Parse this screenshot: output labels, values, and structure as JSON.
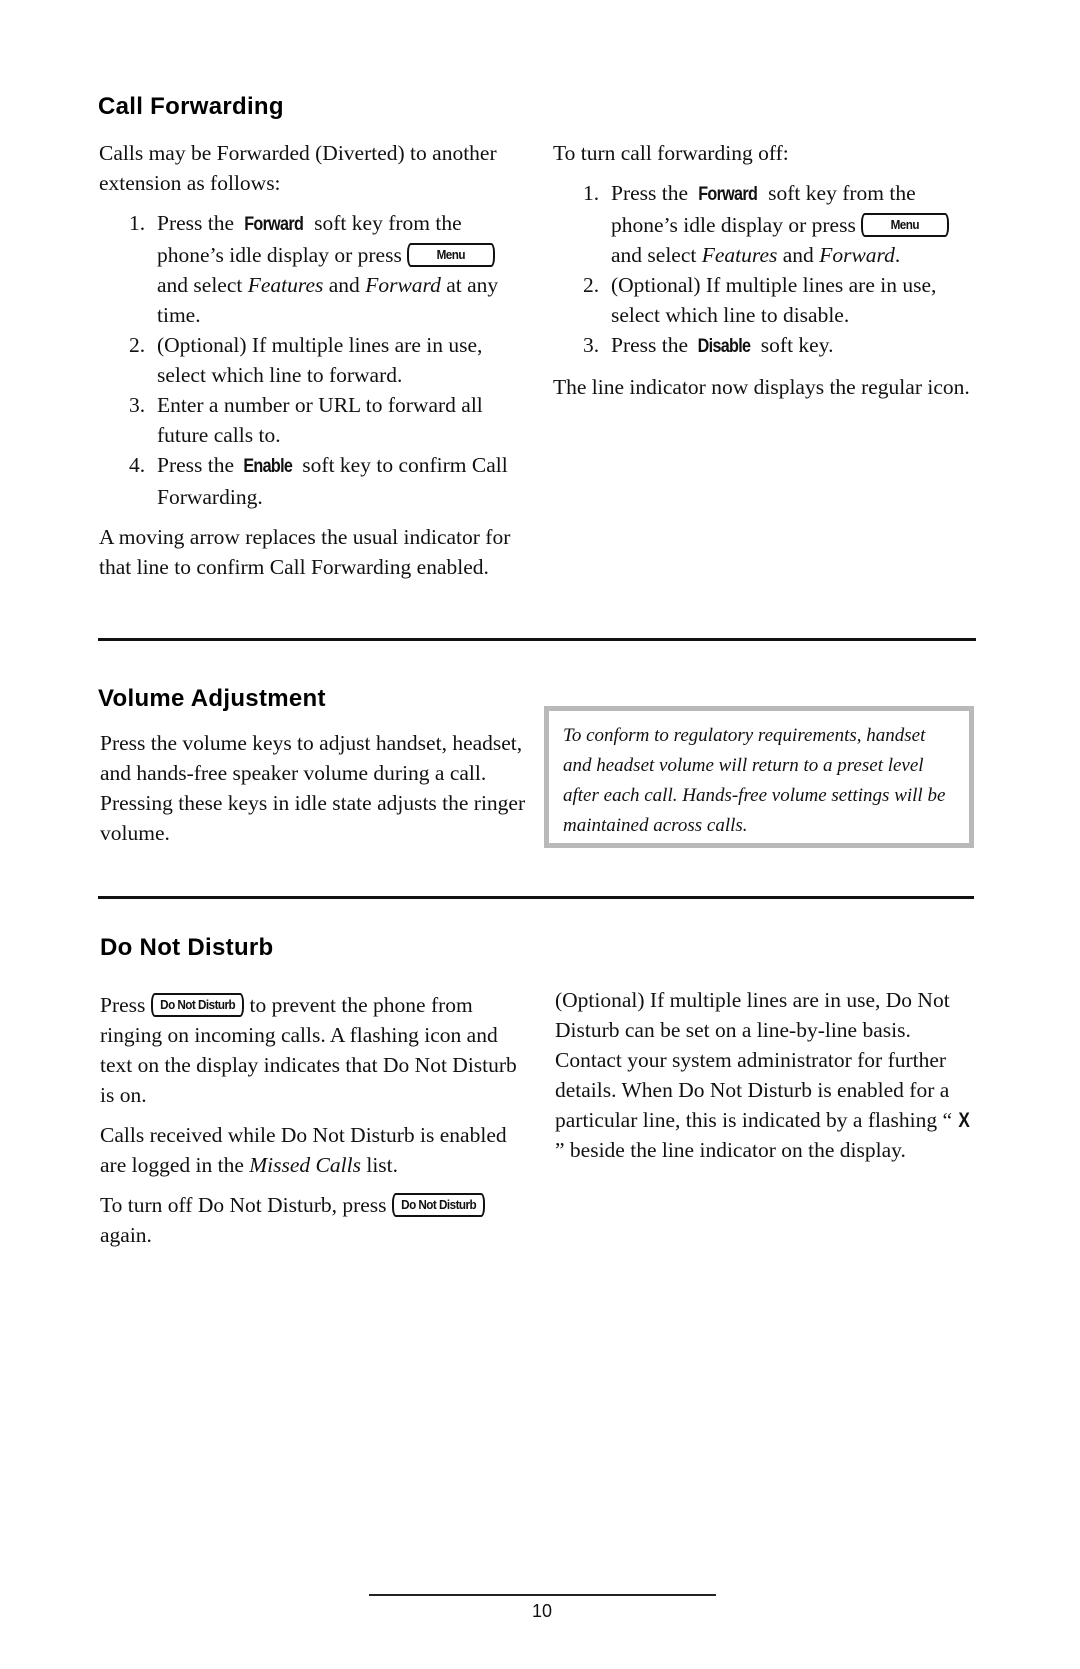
{
  "sections": {
    "call_forwarding": {
      "title": "Call Forwarding",
      "intro": "Calls may be Forwarded (Diverted) to another extension as follows:",
      "steps": [
        {
          "num": "1.",
          "pre": "Press the ",
          "softkey": "Forward",
          "post": " soft key from the phone’s idle display or press ",
          "key": "Menu",
          "post2": " and select ",
          "em1": "Features",
          "mid": " and ",
          "em2": "Forward",
          "end": " at any time."
        },
        {
          "num": "2.",
          "text": "(Optional) If multiple lines are in use, select which line to forward."
        },
        {
          "num": "3.",
          "text": "Enter a number or URL to forward all future calls to."
        },
        {
          "num": "4.",
          "pre": "Press the ",
          "softkey": "Enable",
          "post": " soft key to confirm Call Forwarding."
        }
      ],
      "outro": "A moving arrow replaces the usual indicator for that line to confirm Call Forwarding enabled.",
      "off_intro": "To turn call forwarding off:",
      "off_steps": [
        {
          "num": "1.",
          "pre": "Press the ",
          "softkey": "Forward",
          "post": " soft key from the phone’s idle display or press ",
          "key": "Menu",
          "post2": " and select ",
          "em1": "Features",
          "mid": " and ",
          "em2": "Forward",
          "end": "."
        },
        {
          "num": "2.",
          "text": "(Optional) If multiple lines are in use, select which line to disable."
        },
        {
          "num": "3.",
          "pre": "Press the ",
          "softkey": "Disable",
          "post": " soft key."
        }
      ],
      "off_outro": "The line indicator now displays the regular icon."
    },
    "volume_adjustment": {
      "title": "Volume Adjustment",
      "body": "Press the volume keys to adjust handset, headset, and hands-free speaker volume during a call.  Pressing these keys in idle state adjusts the ringer volume.",
      "note": "To conform to regulatory requirements, handset and headset volume will return to a preset level after each call.  Hands-free volume settings will be maintained across calls."
    },
    "do_not_disturb": {
      "title": "Do Not Disturb",
      "p1_pre": "Press ",
      "key": "Do Not Disturb",
      "p1_post": " to prevent the phone from ringing on incoming calls.  A flashing icon and text on the display indicates that Do Not Disturb is on.",
      "p2_pre": "Calls received while Do Not Disturb is enabled are logged in the ",
      "p2_em": "Missed Calls",
      "p2_post": " list.",
      "p3_pre": "To turn off Do Not Disturb, press ",
      "p3_post": " again.",
      "right_pre": "(Optional) If multiple lines are in use, Do Not Disturb can be set on a line-by-line basis.  Contact your system administrator for further details.  When Do Not Disturb is enabled for a particular line, this is indicated by a flashing “ ",
      "right_glyph": "X",
      "right_post": " ” beside the line indicator on the display."
    }
  },
  "footer": {
    "page_number": "10"
  }
}
